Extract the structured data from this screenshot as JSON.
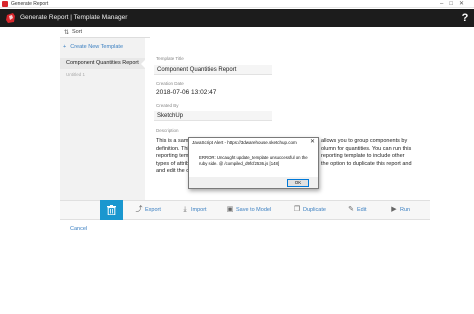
{
  "window": {
    "title": "Generate Report",
    "controls": "–□✕"
  },
  "header": {
    "title": "Generate Report | Template Manager",
    "help_label": "?",
    "brand_color": "#d9262c"
  },
  "sidebar": {
    "sort_label": "Sort",
    "create_new_label": "Create New Template",
    "items": [
      {
        "label": "Component Quantities Report",
        "selected": true
      },
      {
        "label": "Untitled 1",
        "selected": false
      }
    ]
  },
  "form": {
    "template_title_label": "Template Title",
    "template_title_value": "Component Quantities Report",
    "creation_date_label": "Creation Date",
    "creation_date_value": "2018-07-06 13:02:47",
    "created_by_label": "Created By",
    "created_by_value": "SketchUp",
    "description_label": "Description",
    "description_left": [
      "This is a sampl",
      "definition. This",
      "reporting temp",
      "types of attribu",
      "and edit the duplicate."
    ],
    "description_right": [
      "allows you to group components by",
      "olumn for quantities. You can run this",
      "reporting template to include other",
      "the option to duplicate this report and"
    ]
  },
  "toolbar": {
    "accent": "#1a97cf",
    "delete_icon": "trash-icon",
    "buttons": [
      {
        "label": "Export",
        "icon": "export-icon"
      },
      {
        "label": "Import",
        "icon": "import-icon"
      },
      {
        "label": "Save to Model",
        "icon": "save-icon"
      },
      {
        "label": "Duplicate",
        "icon": "duplicate-icon"
      },
      {
        "label": "Edit",
        "icon": "edit-icon"
      },
      {
        "label": "Run",
        "icon": "run-icon"
      }
    ]
  },
  "footer": {
    "cancel_label": "Cancel"
  },
  "dialog": {
    "title": "JavaScript Alert - https://3dwarehouse.sketchup.com",
    "close": "✕",
    "message": "ERROR: Uncaught update_template unsuccessful on the ruby side. @ /compiled_d9fcf2536.js [148]",
    "ok_label": "OK"
  }
}
